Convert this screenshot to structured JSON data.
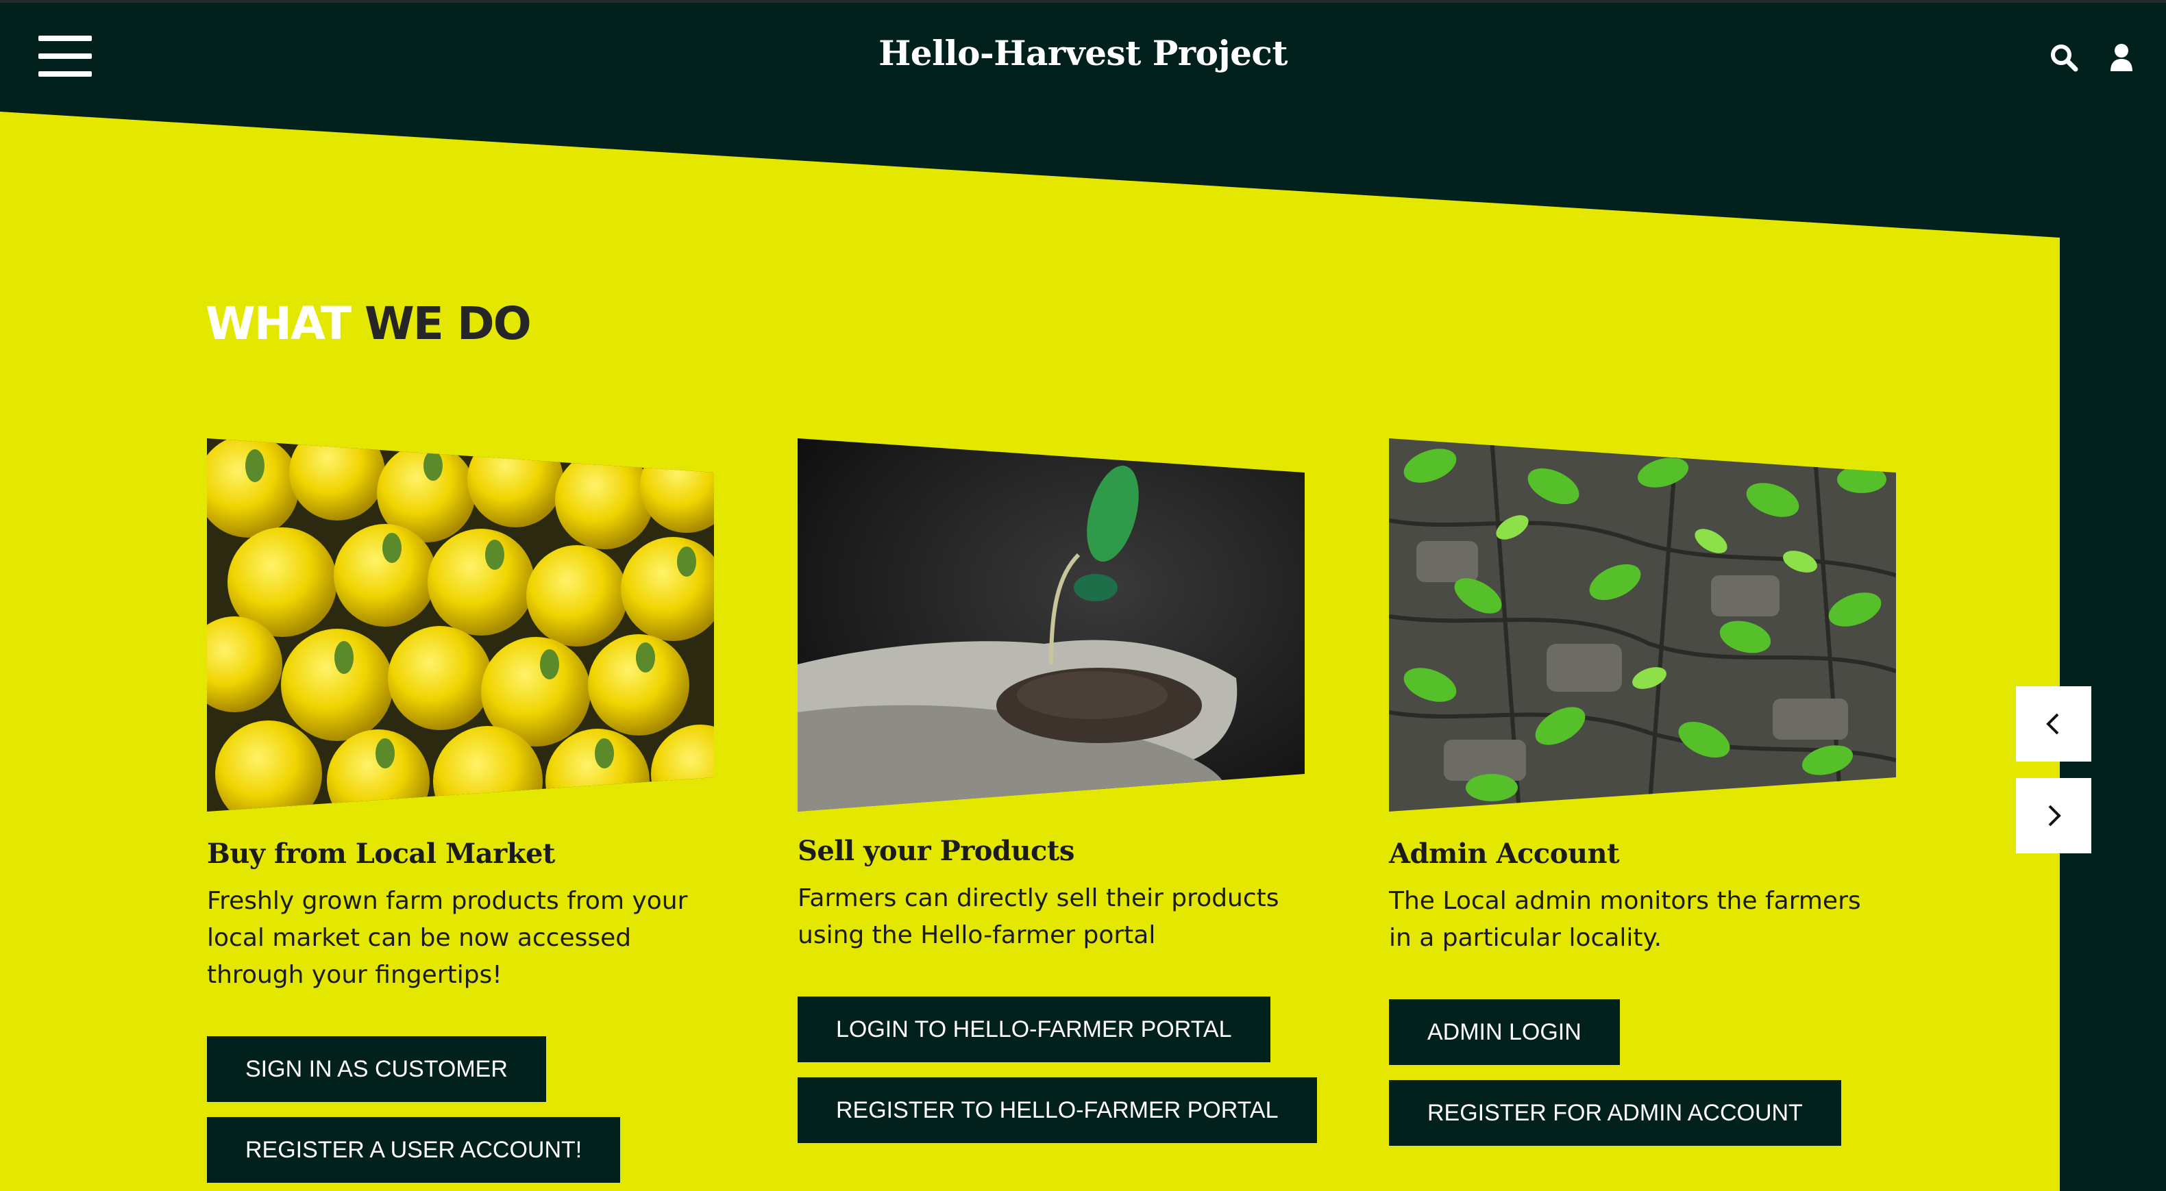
{
  "header": {
    "title": "Hello-Harvest Project",
    "menu_icon": "hamburger-menu-icon",
    "search_icon": "search-icon",
    "user_icon": "user-icon"
  },
  "colors": {
    "dark": "#03211c",
    "accent": "#e4e800",
    "white": "#ffffff"
  },
  "section": {
    "title_part1": "WHAT",
    "title_part2": "WE DO"
  },
  "cards": [
    {
      "title": "Buy from Local Market",
      "text": "Freshly grown farm products from your local market can be now accessed through your fingertips!",
      "image": "yellow-squash-photo",
      "buttons": [
        "SIGN IN AS CUSTOMER",
        "REGISTER A USER ACCOUNT!"
      ]
    },
    {
      "title": "Sell your Products",
      "text": "Farmers can directly sell their products using the Hello-farmer portal",
      "image": "seedling-in-hands-photo",
      "buttons": [
        "LOGIN TO HELLO-FARMER PORTAL",
        "REGISTER TO HELLO-FARMER PORTAL"
      ]
    },
    {
      "title": "Admin Account",
      "text": "The Local admin monitors the farmers in a particular locality.",
      "image": "leaves-on-bark-photo",
      "buttons": [
        "ADMIN LOGIN",
        "REGISTER FOR ADMIN ACCOUNT"
      ]
    }
  ],
  "carousel": {
    "prev_icon": "chevron-left-icon",
    "next_icon": "chevron-right-icon"
  }
}
